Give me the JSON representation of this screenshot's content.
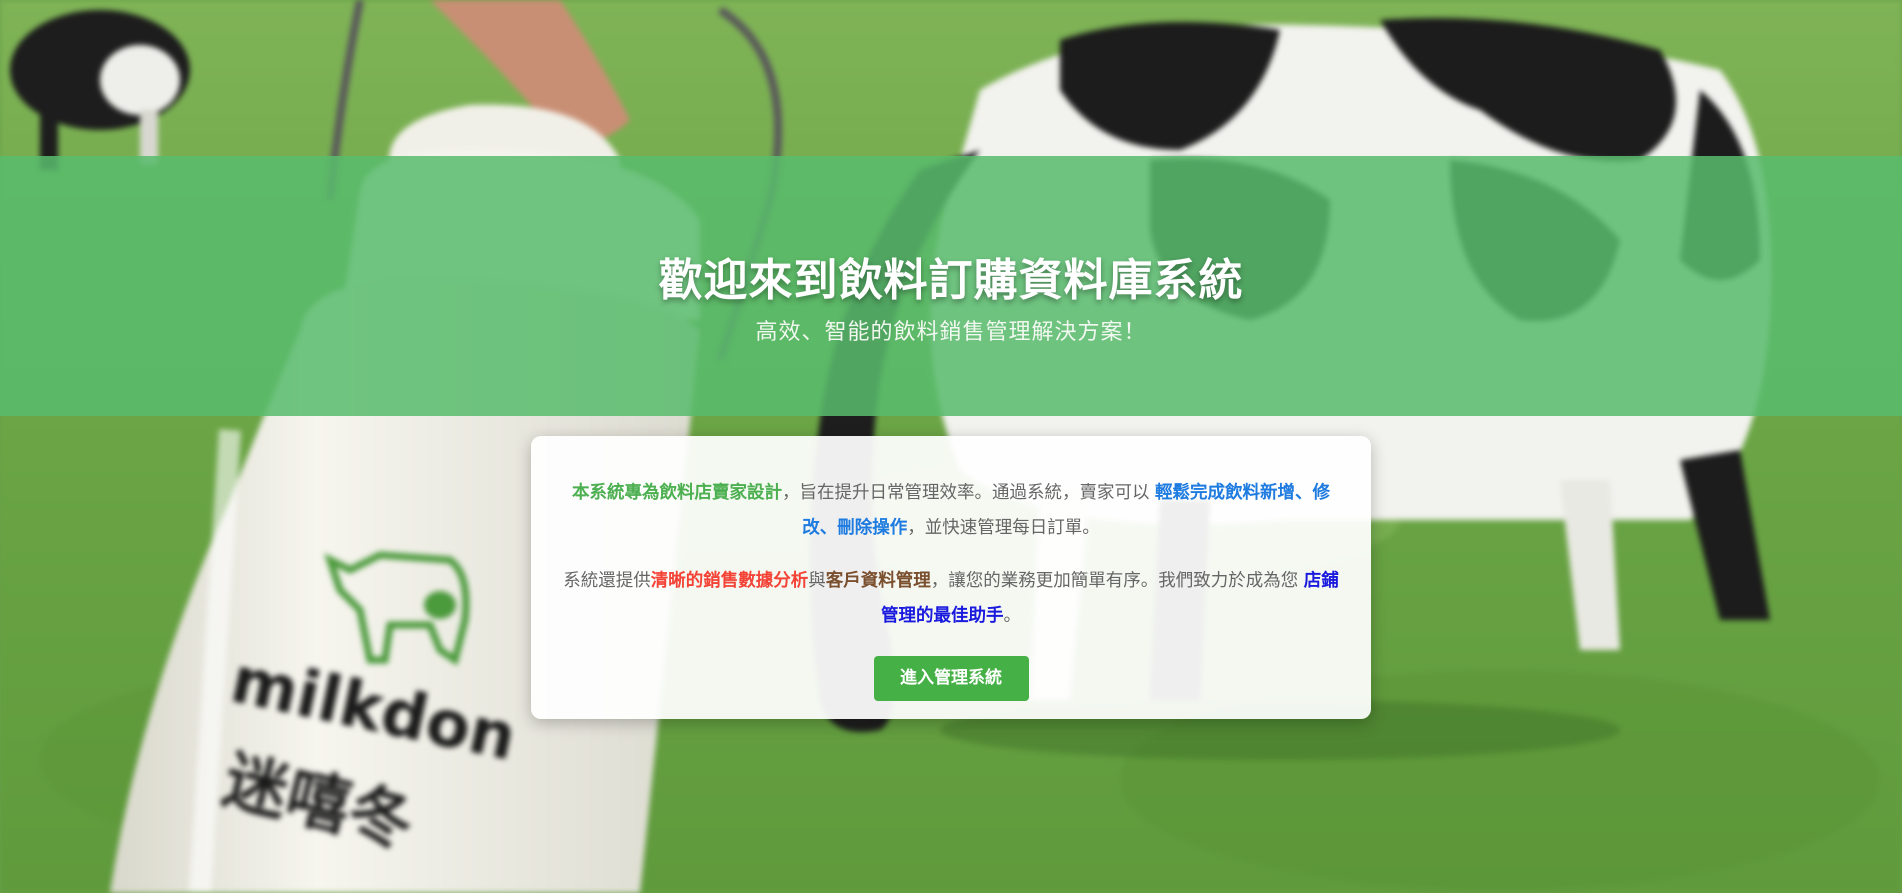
{
  "hero": {
    "title": "歡迎來到飲料訂購資料庫系統",
    "subtitle": "高效、智能的飲料銷售管理解決方案！"
  },
  "intro": {
    "p1_highlight_green": "本系統專為飲料店賣家設計",
    "p1_text_1": "，旨在提升日常管理效率。通過系統，賣家可以 ",
    "p1_highlight_blue_1": "輕鬆完成飲料新增",
    "p1_sep_1": "、",
    "p1_highlight_blue_2": "修改",
    "p1_sep_2": "、",
    "p1_highlight_blue_3": "刪除操作",
    "p1_text_2": "，並快速管理每日訂單。",
    "p2_text_1": "系統還提供",
    "p2_highlight_red": "清晰的銷售數據分析",
    "p2_text_2": "與",
    "p2_highlight_brown": "客戶資料管理",
    "p2_text_3": "，讓您的業務更加簡單有序。我們致力於成為您 ",
    "p2_highlight_navy": "店鋪管理的最佳助手",
    "p2_text_4": "。"
  },
  "actions": {
    "enter_label": "進入管理系統"
  },
  "background": {
    "can_brand": "milkdon",
    "can_brand_cn": "迷嘻冬"
  },
  "colors": {
    "hero_band": "#58bc6c",
    "button": "#45b045",
    "highlight_green": "#4caf50",
    "highlight_blue": "#1e7be0",
    "highlight_red": "#f44336",
    "highlight_brown": "#7a4f2e",
    "highlight_navy": "#1a1adf"
  }
}
